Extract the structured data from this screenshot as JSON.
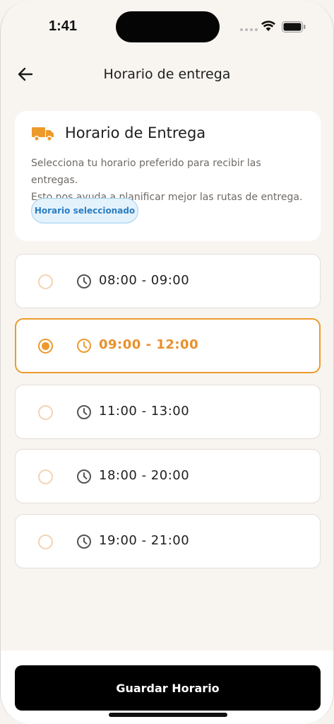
{
  "status_bar": {
    "time": "1:41"
  },
  "header": {
    "title": "Horario de entrega",
    "back_icon": "arrow-left-icon"
  },
  "info_card": {
    "icon": "truck-icon",
    "title": "Horario de Entrega",
    "description_line1": "Selecciona tu horario preferido para recibir las entregas.",
    "description_line2": "Esto nos ayuda a planificar mejor las rutas de entrega.",
    "badge": "Horario seleccionado"
  },
  "slots": [
    {
      "label": "08:00 - 09:00",
      "selected": false
    },
    {
      "label": "09:00 - 12:00",
      "selected": true
    },
    {
      "label": "11:00 - 13:00",
      "selected": false
    },
    {
      "label": "18:00 - 20:00",
      "selected": false
    },
    {
      "label": "19:00 - 21:00",
      "selected": false
    }
  ],
  "footer": {
    "save_label": "Guardar Horario"
  },
  "colors": {
    "accent": "#ec9a2c",
    "badge_text": "#2a7ec2",
    "badge_bg": "#e4f2fc",
    "background": "#f8f5f1",
    "button": "#000000"
  }
}
